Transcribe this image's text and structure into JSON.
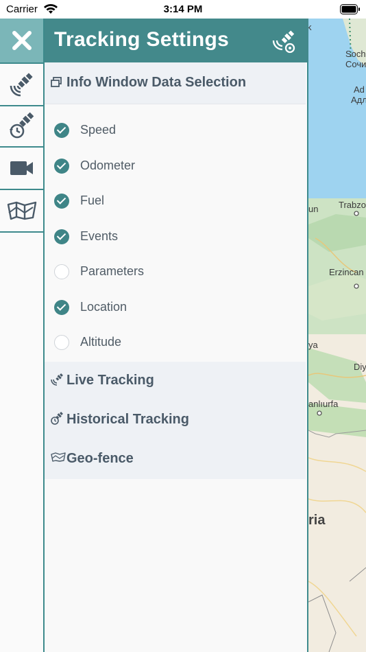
{
  "status_bar": {
    "carrier": "Carrier",
    "time": "3:14 PM"
  },
  "panel": {
    "title": "Tracking Settings"
  },
  "info_section": {
    "title": "Info Window Data Selection",
    "options": [
      {
        "label": "Speed",
        "checked": true
      },
      {
        "label": "Odometer",
        "checked": true
      },
      {
        "label": "Fuel",
        "checked": true
      },
      {
        "label": "Events",
        "checked": true
      },
      {
        "label": "Parameters",
        "checked": false
      },
      {
        "label": "Location",
        "checked": true
      },
      {
        "label": "Altitude",
        "checked": false
      }
    ]
  },
  "sections": {
    "live": {
      "title": "Live Tracking"
    },
    "historical": {
      "title": "Historical Tracking"
    },
    "geofence": {
      "title": "Geo-fence"
    }
  },
  "map_labels": {
    "sochi_latin": "Soch",
    "sochi_cyrillic": "Сочи",
    "adler_latin": "Ad",
    "adler_cyrillic": "Адл",
    "trabzon": "Trabzo",
    "un": "un",
    "erzincan": "Erzincan",
    "ya": "ya",
    "diy": "Diy",
    "sanliurfa": "anlıurfa",
    "ria": "ria",
    "k": "k"
  },
  "colors": {
    "accent": "#43898b",
    "rail_close": "#7bb6b8",
    "checked": "#3f8587"
  }
}
